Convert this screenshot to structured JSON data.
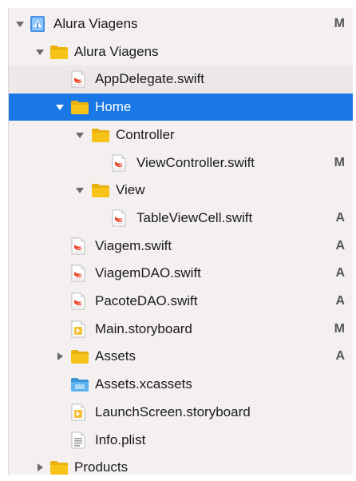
{
  "colors": {
    "selection": "#1a78e6",
    "folder": "#f7c318",
    "swift": "#e8492b",
    "status_text": "#555555"
  },
  "tree": [
    {
      "label": "Alura Viagens",
      "icon": "xcode-project-icon",
      "disclosure": "expanded",
      "status": "M",
      "depth": 0
    },
    {
      "label": "Alura Viagens",
      "icon": "folder-icon",
      "disclosure": "expanded",
      "status": "",
      "depth": 1
    },
    {
      "label": "AppDelegate.swift",
      "icon": "swift-file-icon",
      "disclosure": "none",
      "status": "",
      "depth": 2,
      "alt": true
    },
    {
      "label": "Home",
      "icon": "folder-icon",
      "disclosure": "expanded",
      "status": "",
      "depth": 2,
      "selected": true
    },
    {
      "label": "Controller",
      "icon": "folder-icon",
      "disclosure": "expanded",
      "status": "",
      "depth": 3
    },
    {
      "label": "ViewController.swift",
      "icon": "swift-file-icon",
      "disclosure": "none",
      "status": "M",
      "depth": 4
    },
    {
      "label": "View",
      "icon": "folder-icon",
      "disclosure": "expanded",
      "status": "",
      "depth": 3
    },
    {
      "label": "TableViewCell.swift",
      "icon": "swift-file-icon",
      "disclosure": "none",
      "status": "A",
      "depth": 4
    },
    {
      "label": "Viagem.swift",
      "icon": "swift-file-icon",
      "disclosure": "none",
      "status": "A",
      "depth": 2
    },
    {
      "label": "ViagemDAO.swift",
      "icon": "swift-file-icon",
      "disclosure": "none",
      "status": "A",
      "depth": 2
    },
    {
      "label": "PacoteDAO.swift",
      "icon": "swift-file-icon",
      "disclosure": "none",
      "status": "A",
      "depth": 2
    },
    {
      "label": "Main.storyboard",
      "icon": "storyboard-file-icon",
      "disclosure": "none",
      "status": "M",
      "depth": 2
    },
    {
      "label": "Assets",
      "icon": "folder-icon",
      "disclosure": "collapsed",
      "status": "A",
      "depth": 2
    },
    {
      "label": "Assets.xcassets",
      "icon": "asset-catalog-icon",
      "disclosure": "none",
      "status": "",
      "depth": 2
    },
    {
      "label": "LaunchScreen.storyboard",
      "icon": "storyboard-file-icon",
      "disclosure": "none",
      "status": "",
      "depth": 2
    },
    {
      "label": "Info.plist",
      "icon": "plist-file-icon",
      "disclosure": "none",
      "status": "",
      "depth": 2
    },
    {
      "label": "Products",
      "icon": "folder-icon",
      "disclosure": "collapsed",
      "status": "",
      "depth": 1
    }
  ]
}
